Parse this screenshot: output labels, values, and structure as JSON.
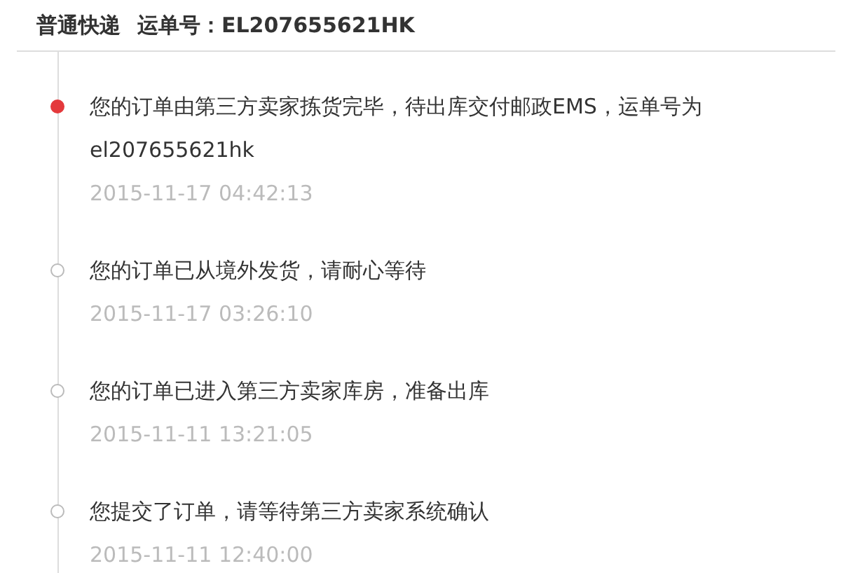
{
  "header": {
    "carrier": "普通快递",
    "tracking": "运单号：EL207655621HK"
  },
  "events": [
    {
      "text": "您的订单由第三方卖家拣货完毕，待出库交付邮政EMS，运单号为el207655621hk",
      "time": "2015-11-17 04:42:13",
      "current": true
    },
    {
      "text": "您的订单已从境外发货，请耐心等待",
      "time": "2015-11-17 03:26:10",
      "current": false
    },
    {
      "text": "您的订单已进入第三方卖家库房，准备出库",
      "time": "2015-11-11 13:21:05",
      "current": false
    },
    {
      "text": "您提交了订单，请等待第三方卖家系统确认",
      "time": "2015-11-11 12:40:00",
      "current": false
    }
  ]
}
